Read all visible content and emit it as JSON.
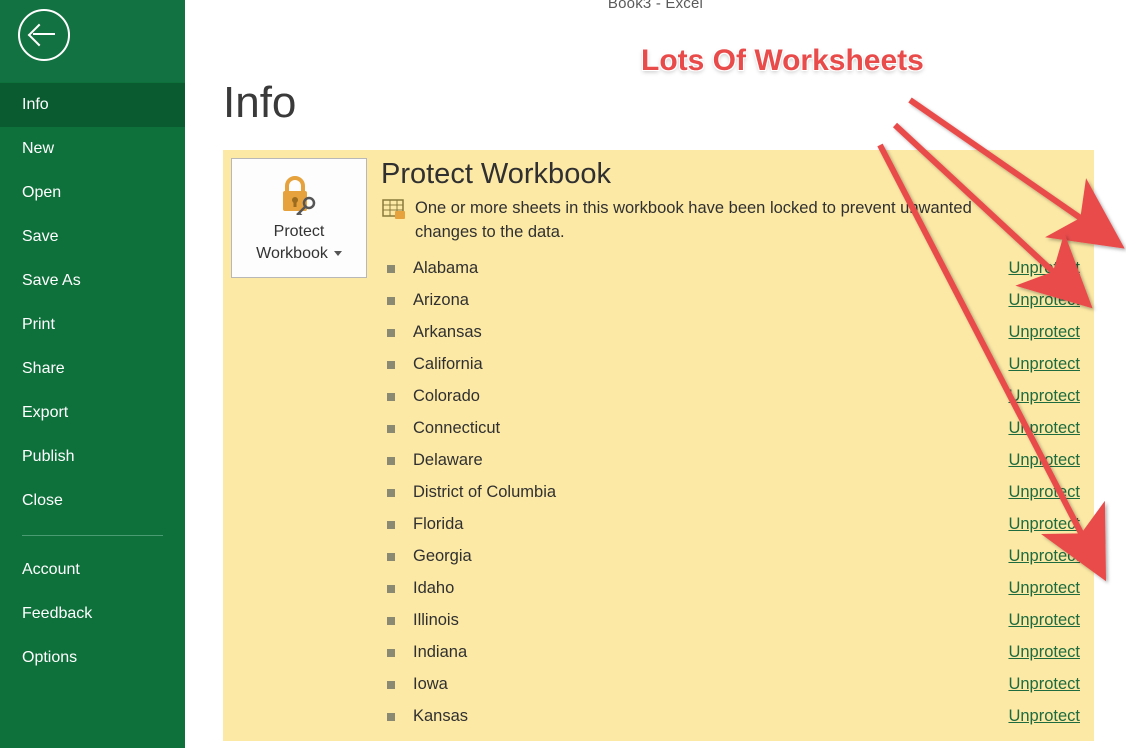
{
  "app_title": "Book3 - Excel",
  "sidebar": {
    "items": [
      {
        "label": "Info",
        "selected": true
      },
      {
        "label": "New"
      },
      {
        "label": "Open"
      },
      {
        "label": "Save"
      },
      {
        "label": "Save As"
      },
      {
        "label": "Print"
      },
      {
        "label": "Share"
      },
      {
        "label": "Export"
      },
      {
        "label": "Publish"
      },
      {
        "label": "Close"
      }
    ],
    "footer_items": [
      {
        "label": "Account"
      },
      {
        "label": "Feedback"
      },
      {
        "label": "Options"
      }
    ]
  },
  "page": {
    "title": "Info",
    "protect": {
      "button_line1": "Protect",
      "button_line2": "Workbook",
      "heading": "Protect Workbook",
      "description": "One or more sheets in this workbook have been locked to prevent unwanted changes to the data.",
      "unprotect_label": "Unprotect",
      "sheets": [
        "Alabama",
        "Arizona",
        "Arkansas",
        "California",
        "Colorado",
        "Connecticut",
        "Delaware",
        "District of Columbia",
        "Florida",
        "Georgia",
        "Idaho",
        "Illinois",
        "Indiana",
        "Iowa",
        "Kansas"
      ]
    }
  },
  "annotation": {
    "text": "Lots Of Worksheets"
  },
  "colors": {
    "excel_green": "#0e713b",
    "panel_yellow": "#fce9a6",
    "annotation_red": "#e94b4b"
  }
}
